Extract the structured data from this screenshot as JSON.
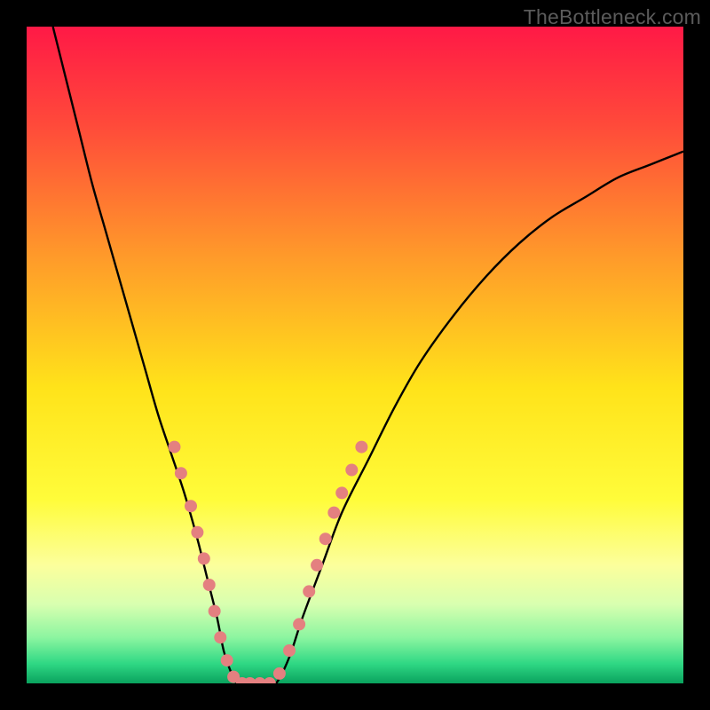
{
  "watermark": "TheBottleneck.com",
  "colors": {
    "frame_bg": "#000000",
    "curve_stroke": "#000000",
    "marker_fill": "#e48080",
    "marker_stroke": "#c76a6a"
  },
  "chart_data": {
    "type": "line",
    "title": "",
    "xlabel": "",
    "ylabel": "",
    "xlim": [
      0,
      100
    ],
    "ylim": [
      0,
      100
    ],
    "gradient_stops": [
      {
        "offset": 0,
        "color": "#ff1946"
      },
      {
        "offset": 0.15,
        "color": "#ff4a3a"
      },
      {
        "offset": 0.35,
        "color": "#ff9a2a"
      },
      {
        "offset": 0.55,
        "color": "#ffe31a"
      },
      {
        "offset": 0.72,
        "color": "#fffc3a"
      },
      {
        "offset": 0.82,
        "color": "#fcff9c"
      },
      {
        "offset": 0.88,
        "color": "#d8ffb0"
      },
      {
        "offset": 0.93,
        "color": "#8cf5a0"
      },
      {
        "offset": 0.97,
        "color": "#2fd884"
      },
      {
        "offset": 1.0,
        "color": "#0aa25e"
      }
    ],
    "series": [
      {
        "name": "left-branch",
        "x": [
          4,
          6,
          8,
          10,
          12,
          14,
          16,
          18,
          20,
          22,
          24,
          26,
          27.5,
          29,
          30,
          31,
          32
        ],
        "y": [
          100,
          92,
          84,
          76,
          69,
          62,
          55,
          48,
          41,
          35,
          29,
          22,
          16,
          10,
          5,
          2,
          0
        ]
      },
      {
        "name": "floor",
        "x": [
          32,
          33,
          34,
          35,
          36,
          37,
          38
        ],
        "y": [
          0,
          0,
          0,
          0,
          0,
          0,
          0
        ]
      },
      {
        "name": "right-branch",
        "x": [
          38,
          40,
          42,
          45,
          48,
          52,
          56,
          60,
          65,
          70,
          75,
          80,
          85,
          90,
          95,
          100
        ],
        "y": [
          0,
          4,
          10,
          18,
          26,
          34,
          42,
          49,
          56,
          62,
          67,
          71,
          74,
          77,
          79,
          81
        ]
      }
    ],
    "markers": [
      {
        "x": 22.5,
        "y": 36
      },
      {
        "x": 23.5,
        "y": 32
      },
      {
        "x": 25.0,
        "y": 27
      },
      {
        "x": 26.0,
        "y": 23
      },
      {
        "x": 27.0,
        "y": 19
      },
      {
        "x": 27.8,
        "y": 15
      },
      {
        "x": 28.6,
        "y": 11
      },
      {
        "x": 29.5,
        "y": 7
      },
      {
        "x": 30.5,
        "y": 3.5
      },
      {
        "x": 31.5,
        "y": 1.0
      },
      {
        "x": 32.8,
        "y": 0.0
      },
      {
        "x": 34.0,
        "y": 0.0
      },
      {
        "x": 35.5,
        "y": 0.0
      },
      {
        "x": 37.0,
        "y": 0.0
      },
      {
        "x": 38.5,
        "y": 1.5
      },
      {
        "x": 40.0,
        "y": 5.0
      },
      {
        "x": 41.5,
        "y": 9.0
      },
      {
        "x": 43.0,
        "y": 14.0
      },
      {
        "x": 44.2,
        "y": 18.0
      },
      {
        "x": 45.5,
        "y": 22.0
      },
      {
        "x": 46.8,
        "y": 26.0
      },
      {
        "x": 48.0,
        "y": 29.0
      },
      {
        "x": 49.5,
        "y": 32.5
      },
      {
        "x": 51.0,
        "y": 36.0
      }
    ],
    "marker_radius_px": 7
  }
}
